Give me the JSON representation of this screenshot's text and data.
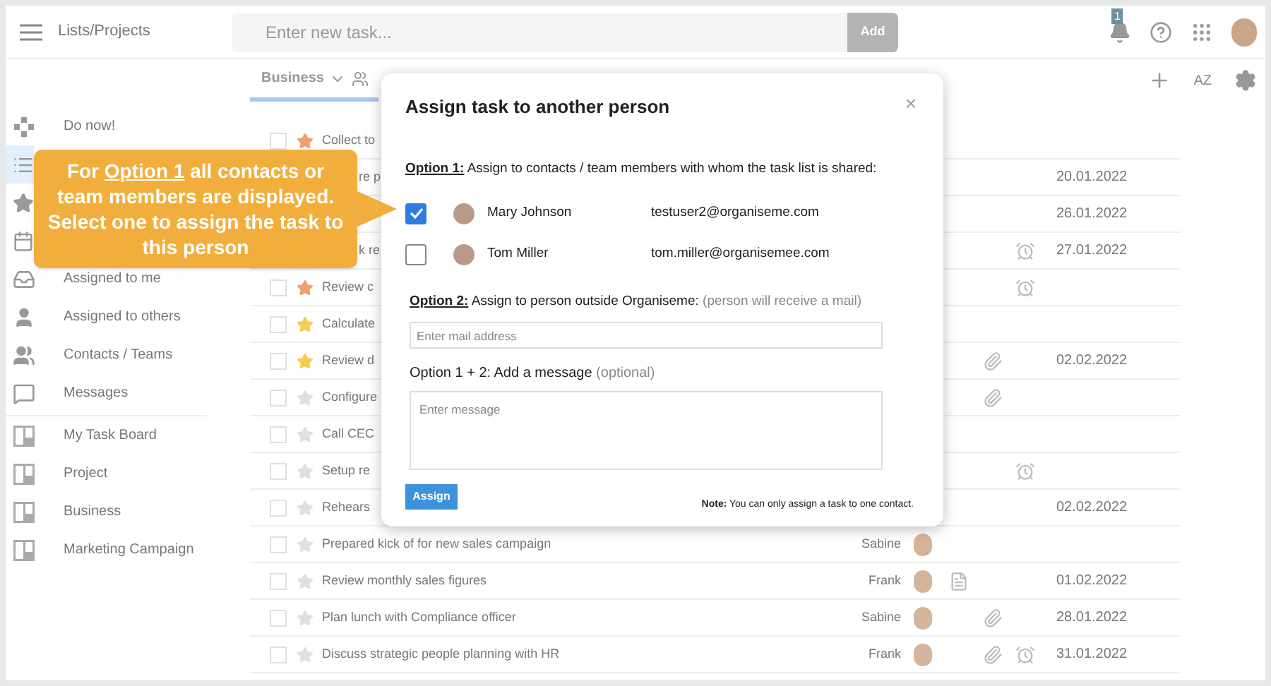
{
  "header": {
    "title": "Lists/Projects",
    "task_input": {
      "placeholder": "Enter new task..."
    },
    "add_button": "Add",
    "notification_count": "1"
  },
  "toolbar": {
    "tab": {
      "label": "Business",
      "selected": true
    },
    "sort_label": "AZ"
  },
  "sidebar": {
    "items": [
      {
        "label": "Do now!",
        "selected": false
      },
      {
        "selected": true
      },
      {
        "selected": false
      },
      {
        "selected": false
      },
      {
        "label": "Assigned to me",
        "selected": false
      },
      {
        "label": "Assigned to others",
        "selected": false
      },
      {
        "label": "Contacts / Teams",
        "selected": false
      },
      {
        "label": "Messages",
        "selected": false
      }
    ],
    "boards": [
      {
        "label": "My Task Board",
        "selected": false
      },
      {
        "label": "Project",
        "selected": false
      },
      {
        "label": "Business",
        "selected": false
      },
      {
        "label": "Marketing Campaign",
        "selected": false
      }
    ]
  },
  "tasks": [
    {
      "kind": "full",
      "text": "Collect to",
      "checked": false,
      "color": "#f0a070"
    },
    {
      "kind": "partial",
      "text": "re p",
      "date": "20.01.2022"
    },
    {
      "kind": "partial",
      "date": "26.01.2022"
    },
    {
      "kind": "partial",
      "text": "k re",
      "alarm": true,
      "date": "27.01.2022"
    },
    {
      "kind": "full",
      "text": "Review c",
      "checked": false,
      "color": "#f0a070",
      "alarm": true
    },
    {
      "kind": "full",
      "text": "Calculate",
      "checked": false,
      "color": "#f5cd55"
    },
    {
      "kind": "full",
      "text": "Review d",
      "checked": false,
      "color": "#f5cd55",
      "attachment": true,
      "date": "02.02.2022"
    },
    {
      "kind": "full",
      "text": "Configure",
      "checked": false,
      "color": "#e0e0e0",
      "attachment": true
    },
    {
      "kind": "full",
      "text": "Call CEC",
      "checked": false,
      "color": "#e0e0e0"
    },
    {
      "kind": "full",
      "text": "Setup re",
      "checked": false,
      "color": "#e0e0e0",
      "alarm": true
    },
    {
      "kind": "full",
      "text": "Rehears",
      "checked": false,
      "color": "#e0e0e0",
      "date": "02.02.2022"
    },
    {
      "kind": "full",
      "text": "Prepared kick of for new sales campaign",
      "checked": false,
      "color": "#e0e0e0",
      "assignee": "Sabine"
    },
    {
      "kind": "full",
      "text": "Review monthly sales figures",
      "checked": false,
      "color": "#e0e0e0",
      "assignee": "Frank",
      "note": true,
      "date": "01.02.2022"
    },
    {
      "kind": "full",
      "text": "Plan lunch with Compliance officer",
      "checked": false,
      "color": "#e0e0e0",
      "assignee": "Sabine",
      "attachment": true,
      "date": "28.01.2022"
    },
    {
      "kind": "full",
      "text": "Discuss strategic people planning with HR",
      "checked": false,
      "color": "#e0e0e0",
      "assignee": "Frank",
      "attachment": true,
      "alarm": true,
      "date": "31.01.2022"
    }
  ],
  "dialog": {
    "title": "Assign task to another person",
    "close": "×",
    "option1": {
      "label": "Option 1:",
      "text": "Assign to contacts / team members with whom the task list is shared:"
    },
    "contacts": [
      {
        "name": "Mary Johnson",
        "email": "testuser2@organiseme.com",
        "checked": true
      },
      {
        "name": "Tom Miller",
        "email": "tom.miller@organisemee.com",
        "checked": false
      }
    ],
    "option2": {
      "label": "Option 2:",
      "text": "Assign to person outside Organiseme:",
      "hint": "(person will receive a mail)"
    },
    "mail_input": {
      "placeholder": "Enter mail address"
    },
    "message_label": {
      "text": "Option 1 + 2: Add a message",
      "hint": "(optional)"
    },
    "message_input": {
      "placeholder": "Enter message"
    },
    "assign_button": "Assign",
    "note": "**Note:** You can only assign a task to one contact."
  },
  "callout": {
    "before": "For",
    "link": "Option 1",
    "after": "all contacts or team members are displayed. Select one to assign the task to this person"
  }
}
